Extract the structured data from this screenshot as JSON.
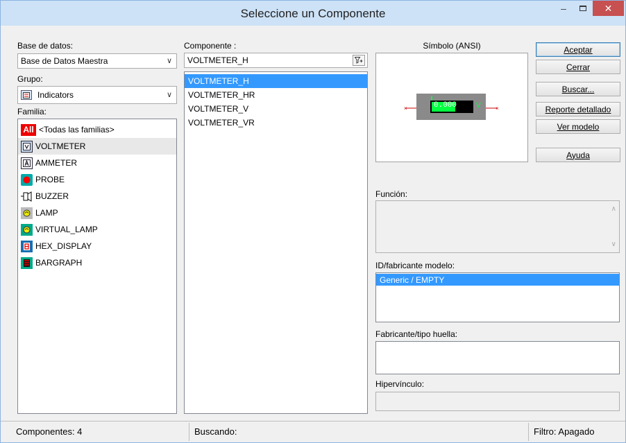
{
  "window": {
    "title": "Seleccione un Componente",
    "minimize": "–",
    "close": "✕"
  },
  "left": {
    "database_label": "Base de datos:",
    "database_value": "Base de Datos Maestra",
    "group_label": "Grupo:",
    "group_value": "Indicators",
    "family_label": "Familia:",
    "families": [
      {
        "label": "<Todas las familias>",
        "icon": "all-families-icon",
        "icon_text": "All"
      },
      {
        "label": "VOLTMETER",
        "icon": "voltmeter-icon",
        "icon_text": "V"
      },
      {
        "label": "AMMETER",
        "icon": "ammeter-icon",
        "icon_text": "A"
      },
      {
        "label": "PROBE",
        "icon": "probe-icon",
        "icon_text": ""
      },
      {
        "label": "BUZZER",
        "icon": "buzzer-icon",
        "icon_text": ""
      },
      {
        "label": "LAMP",
        "icon": "lamp-icon",
        "icon_text": ""
      },
      {
        "label": "VIRTUAL_LAMP",
        "icon": "virtual-lamp-icon",
        "icon_text": ""
      },
      {
        "label": "HEX_DISPLAY",
        "icon": "hex-display-icon",
        "icon_text": ""
      },
      {
        "label": "BARGRAPH",
        "icon": "bargraph-icon",
        "icon_text": ""
      }
    ]
  },
  "middle": {
    "component_label": "Componente :",
    "component_input": "VOLTMETER_H",
    "components": [
      "VOLTMETER_H",
      "VOLTMETER_HR",
      "VOLTMETER_V",
      "VOLTMETER_VR"
    ]
  },
  "right": {
    "symbol_label": "Símbolo (ANSI)",
    "symbol_display": "0.000",
    "symbol_unit": "V",
    "function_label": "Función:",
    "model_label": "ID/fabricante modelo:",
    "model_items": [
      "Generic / EMPTY"
    ],
    "footprint_label": "Fabricante/tipo huella:",
    "hyperlink_label": "Hipervínculo:"
  },
  "buttons": {
    "accept": "Aceptar",
    "close": "Cerrar",
    "search": "Buscar...",
    "report": "Reporte detallado",
    "model": "Ver modelo",
    "help": "Ayuda"
  },
  "status": {
    "components": "Componentes: 4",
    "searching": "Buscando:",
    "filter": "Filtro: Apagado"
  },
  "colors": {
    "selection": "#3399ff",
    "titlebar": "#cde2f7",
    "close_button": "#c75050"
  }
}
